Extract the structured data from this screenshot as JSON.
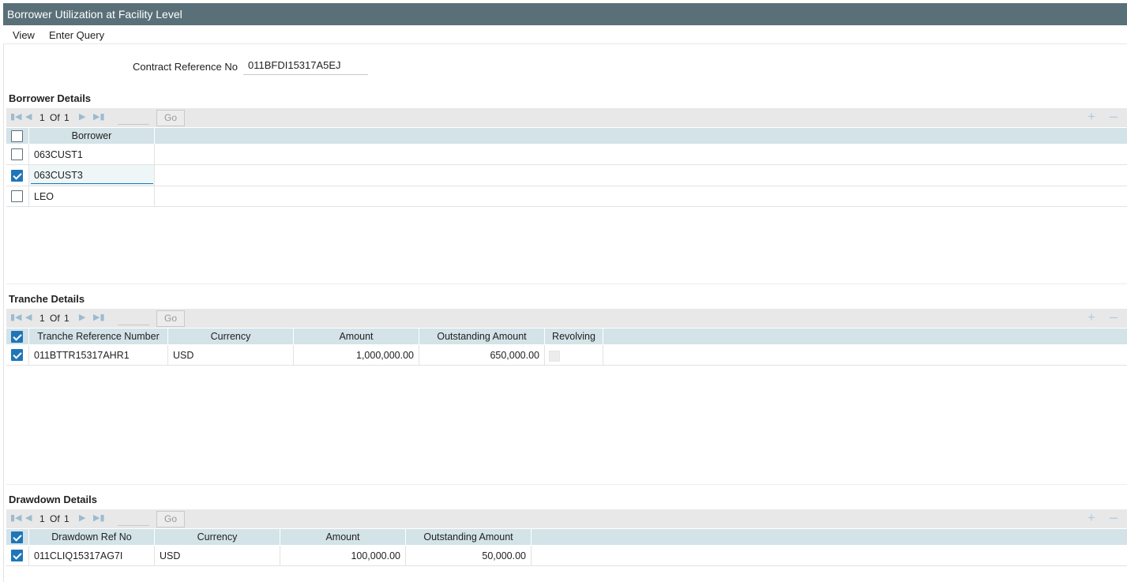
{
  "window": {
    "title": "Borrower Utilization at Facility Level"
  },
  "menu": {
    "view": "View",
    "enter_query": "Enter Query"
  },
  "contract": {
    "label": "Contract Reference No",
    "value": "011BFDI15317A5EJ"
  },
  "pager": {
    "current": "1",
    "of": "Of",
    "total": "1",
    "go": "Go"
  },
  "borrower": {
    "title": "Borrower Details",
    "column": "Borrower",
    "rows": [
      {
        "name": "063CUST1",
        "checked": false
      },
      {
        "name": "063CUST3",
        "checked": true
      },
      {
        "name": "LEO",
        "checked": false
      }
    ]
  },
  "tranche": {
    "title": "Tranche Details",
    "columns": [
      "Tranche Reference Number",
      "Currency",
      "Amount",
      "Outstanding Amount",
      "Revolving"
    ],
    "rows": [
      {
        "ref": "011BTTR15317AHR1",
        "currency": "USD",
        "amount": "1,000,000.00",
        "outstanding": "650,000.00",
        "revolving": false,
        "checked": true
      }
    ]
  },
  "drawdown": {
    "title": "Drawdown Details",
    "columns": [
      "Drawdown Ref No",
      "Currency",
      "Amount",
      "Outstanding Amount"
    ],
    "rows": [
      {
        "ref": "011CLIQ15317AG7I",
        "currency": "USD",
        "amount": "100,000.00",
        "outstanding": "50,000.00",
        "checked": true
      }
    ]
  },
  "colors": {
    "titlebar": "#5a7078",
    "header_row": "#d3e3e8",
    "checkbox_on": "#1e76b8",
    "toolbar": "#e8e8e8"
  }
}
